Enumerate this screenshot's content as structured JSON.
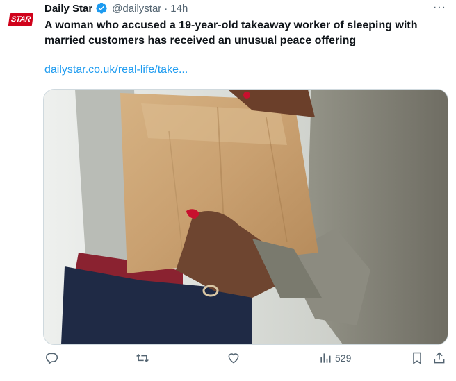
{
  "account": {
    "logo_text": "STAR",
    "name": "Daily Star",
    "handle": "@dailystar",
    "separator": "·",
    "time": "14h",
    "more_label": "···"
  },
  "tweet": {
    "headline": "A woman who accused a 19-year-old takeaway worker of sleeping with married customers has received an unusual peace offering",
    "link_text": "dailystar.co.uk/real-life/take..."
  },
  "actions": {
    "views_count": "529"
  },
  "colors": {
    "brand": "#d0021b",
    "verified": "#1d9bf0",
    "link": "#1d9bf0",
    "muted": "#536471"
  }
}
